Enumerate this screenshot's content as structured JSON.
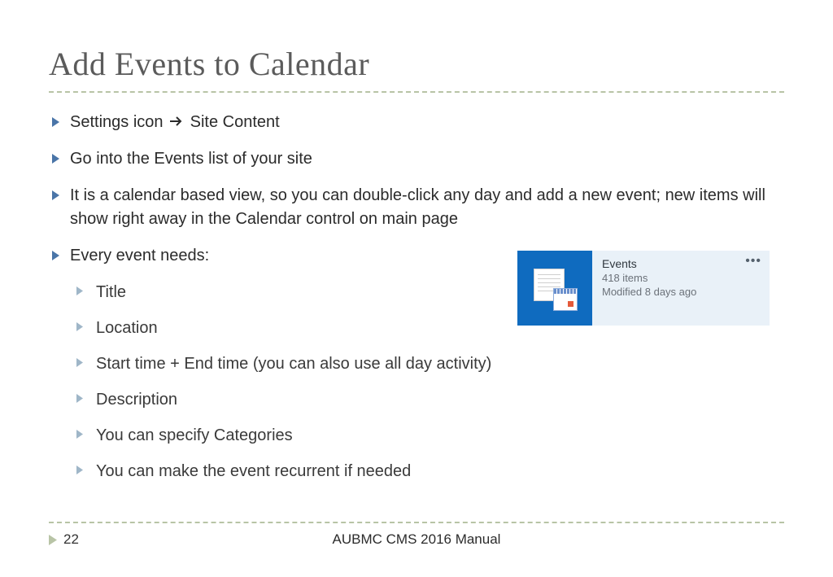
{
  "title": "Add Events to Calendar",
  "bullets": [
    {
      "pre": "Settings icon ",
      "post": " Site Content",
      "arrow": true
    },
    {
      "text": "Go into the Events list of your site"
    },
    {
      "text": "It is a calendar based view, so you can double-click any day and add a new event; new items will show right away in the Calendar control on main page"
    },
    {
      "text": "Every event needs:"
    }
  ],
  "sub_bullets": [
    "Title",
    "Location",
    "Start time + End time (you can also use all day activity)",
    "Description",
    "You can specify Categories",
    "You can make the event recurrent if needed"
  ],
  "tile": {
    "title": "Events",
    "line1": "418 items",
    "line2": "Modified 8 days ago"
  },
  "footer": {
    "page": "22",
    "center": "AUBMC CMS 2016 Manual"
  },
  "colors": {
    "bullet_arrow": "#4a75a8",
    "sub_arrow": "#9fb6c8",
    "tile_bg": "#e9f1f8",
    "tile_icon_bg": "#0f6bbf"
  }
}
